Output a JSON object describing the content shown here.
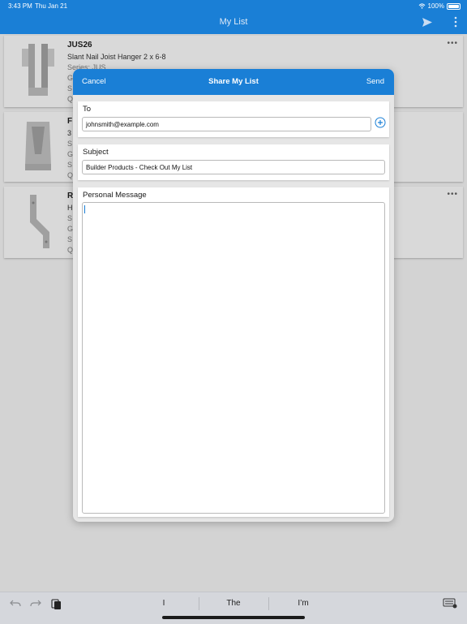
{
  "status_bar": {
    "time": "3:43 PM",
    "date": "Thu Jan 21",
    "battery": "100%"
  },
  "nav": {
    "title": "My List",
    "send_icon": "send-icon",
    "more_icon": "more-vertical-icon"
  },
  "list": [
    {
      "name": "JUS26",
      "description": "Slant Nail Joist Hanger 2 x 6-8",
      "meta": [
        "Series: JUS",
        "G",
        "S",
        "Q"
      ]
    },
    {
      "name": "F",
      "description": "3",
      "meta": [
        "S",
        "G",
        "S",
        "Q"
      ]
    },
    {
      "name": "R",
      "description": "H",
      "meta": [
        "S",
        "G",
        "S",
        "Q"
      ]
    }
  ],
  "modal": {
    "cancel_label": "Cancel",
    "title": "Share My List",
    "send_label": "Send",
    "to": {
      "label": "To",
      "value": "johnsmith@example.com"
    },
    "subject": {
      "label": "Subject",
      "value": "Builder Products - Check Out My List"
    },
    "message": {
      "label": "Personal Message",
      "value": ""
    }
  },
  "keyboard_bar": {
    "suggestions": [
      "I",
      "The",
      "I’m"
    ],
    "icons": [
      "undo-icon",
      "redo-icon",
      "paste-icon",
      "keyboard-icon"
    ]
  },
  "colors": {
    "accent": "#1a7fd6"
  }
}
